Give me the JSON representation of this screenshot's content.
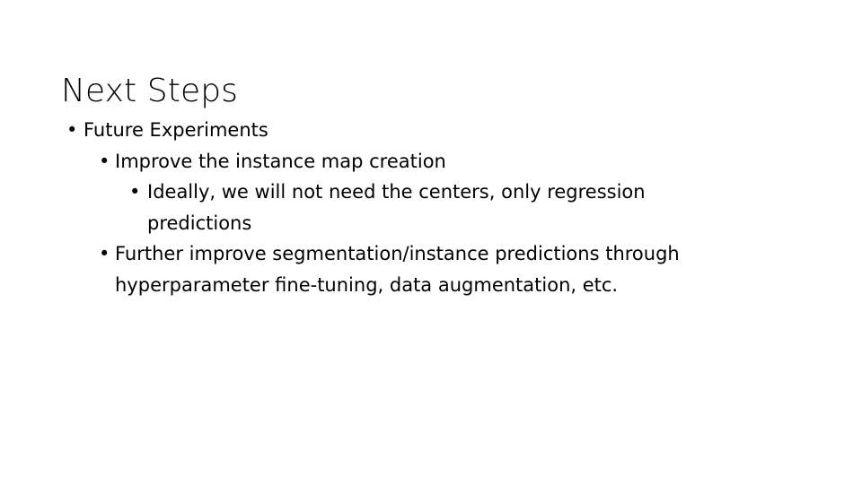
{
  "slide": {
    "title": "Next Steps",
    "background_color": "#ffffff",
    "text_color": "#000000",
    "bullet_glyph": "•",
    "content": [
      {
        "level": 1,
        "text": "Future Experiments"
      },
      {
        "level": 2,
        "text": "Improve the instance map creation"
      },
      {
        "level": 3,
        "text": "Ideally, we will not need the centers, only regression predictions"
      },
      {
        "level": 2,
        "text": "Further improve segmentation/instance predictions through hyperparameter fine-tuning, data augmentation, etc."
      }
    ]
  }
}
